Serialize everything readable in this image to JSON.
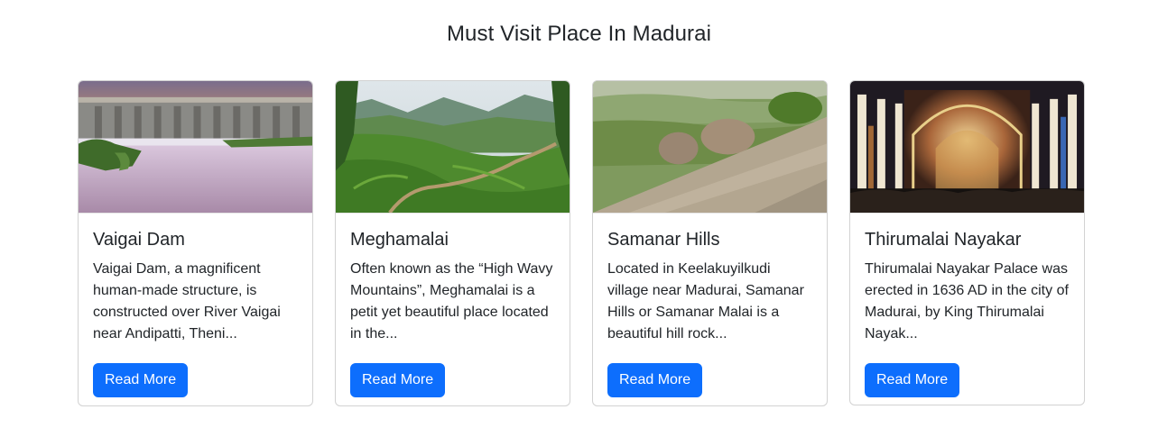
{
  "page": {
    "title": "Must Visit Place In Madurai"
  },
  "cards": [
    {
      "title": "Vaigai Dam",
      "text": "Vaigai Dam, a magnificent human-made structure, is constructed over River Vaigai near Andipatti, Theni...",
      "button": "Read More",
      "image_icon": "dam-photo"
    },
    {
      "title": "Meghamalai",
      "text": "Often known as the “High Wavy Mountains”, Meghamalai is a petit yet beautiful place located in the...",
      "button": "Read More",
      "image_icon": "tea-hills-photo"
    },
    {
      "title": "Samanar Hills",
      "text": "Located in Keelakuyilkudi village near Madurai, Samanar Hills or Samanar Malai is a beautiful hill rock...",
      "button": "Read More",
      "image_icon": "rock-hill-photo"
    },
    {
      "title": "Thirumalai Nayakar",
      "text": "Thirumalai Nayakar Palace was erected in 1636 AD in the city of Madurai, by King Thirumalai Nayak...",
      "button": "Read More",
      "image_icon": "palace-photo"
    }
  ],
  "colors": {
    "primary": "#0d6efd",
    "text": "#212529",
    "border": "#d9d9d9"
  }
}
